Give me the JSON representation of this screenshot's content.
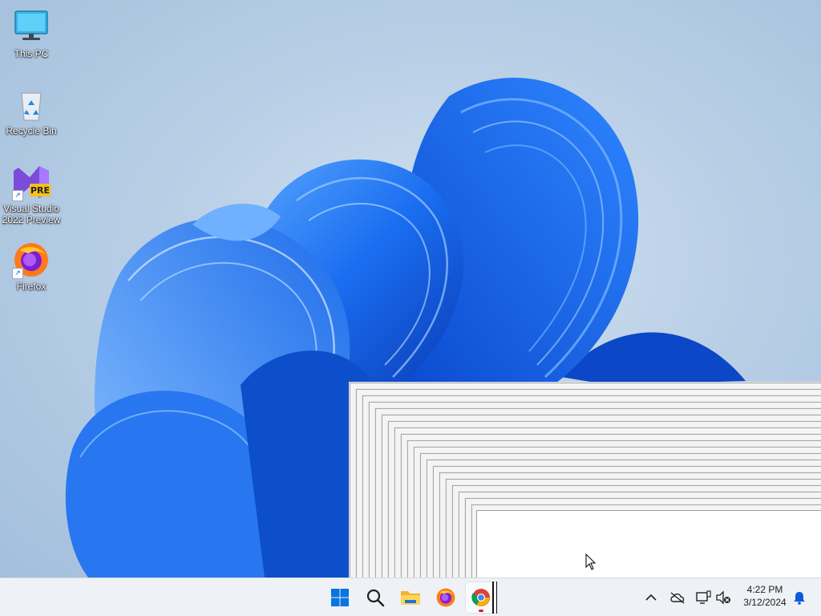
{
  "desktop": {
    "icons": [
      {
        "label": "This PC",
        "icon": "computer-icon"
      },
      {
        "label": "Recycle Bin",
        "icon": "recycle-bin-icon"
      },
      {
        "label_line1": "Visual Studio",
        "label_line2": "2022 Preview",
        "badge": "PRE",
        "icon": "visual-studio-icon"
      },
      {
        "label": "Firefox",
        "icon": "firefox-icon"
      }
    ]
  },
  "taskbar": {
    "apps": [
      "start-icon",
      "search-icon",
      "file-explorer-icon",
      "firefox-icon",
      "chrome-icon"
    ],
    "tray": [
      "chevron-up-icon",
      "cloud-off-icon",
      "network-icon",
      "volume-muted-icon",
      "notification-bell-icon"
    ],
    "clock": {
      "time": "4:22 PM",
      "date": "3/12/2024"
    }
  },
  "colors": {
    "accent": "#0a5cd8",
    "bloom_light": "#3b8cff",
    "bloom_dark": "#0838a8",
    "taskbar_bg": "#eef1f5"
  }
}
